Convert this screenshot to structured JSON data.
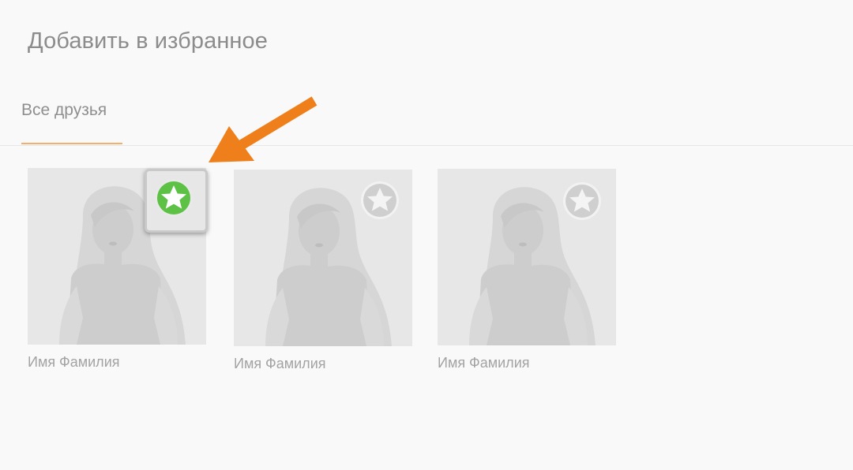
{
  "page": {
    "title": "Добавить в избранное"
  },
  "tabs": [
    {
      "label": "Все друзья",
      "active": true
    }
  ],
  "friends": [
    {
      "name": "Имя Фамилия",
      "favorite": true,
      "icon": "star-icon"
    },
    {
      "name": "Имя Фамилия",
      "favorite": false,
      "icon": "star-icon"
    },
    {
      "name": "Имя Фамилия",
      "favorite": false,
      "icon": "star-icon"
    }
  ],
  "colors": {
    "accent_tab": "#f0b06c",
    "favorite_active": "#5cc144",
    "favorite_inactive": "#cfcfcf",
    "annotation_arrow": "#ef7f1a"
  }
}
